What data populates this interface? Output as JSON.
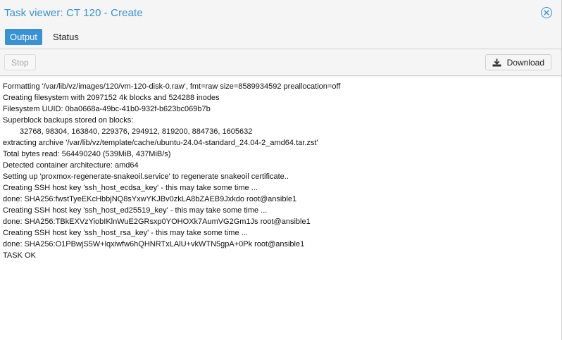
{
  "window": {
    "title": "Task viewer: CT 120 - Create"
  },
  "tabs": [
    {
      "label": "Output",
      "active": true
    },
    {
      "label": "Status",
      "active": false
    }
  ],
  "toolbar": {
    "stop_label": "Stop",
    "download_label": "Download"
  },
  "icons": {
    "close": "close-circle-icon",
    "download": "download-icon"
  },
  "colors": {
    "accent": "#3892d4"
  },
  "output": {
    "lines": [
      "Formatting '/var/lib/vz/images/120/vm-120-disk-0.raw', fmt=raw size=8589934592 preallocation=off",
      "Creating filesystem with 2097152 4k blocks and 524288 inodes",
      "Filesystem UUID: 0ba0668a-49bc-41b0-932f-b623bc069b7b",
      "Superblock backups stored on blocks:",
      "32768, 98304, 163840, 229376, 294912, 819200, 884736, 1605632",
      "extracting archive '/var/lib/vz/template/cache/ubuntu-24.04-standard_24.04-2_amd64.tar.zst'",
      "Total bytes read: 564490240 (539MiB, 437MiB/s)",
      "Detected container architecture: amd64",
      "Setting up 'proxmox-regenerate-snakeoil.service' to regenerate snakeoil certificate..",
      "Creating SSH host key 'ssh_host_ecdsa_key' - this may take some time ...",
      "done: SHA256:fwstTyeEKcHbbjNQ8sYxwYKJBv0zkLA8bZAEB9Jxkdo root@ansible1",
      "Creating SSH host key 'ssh_host_ed25519_key' - this may take some time ...",
      "done: SHA256:TBkEXVzYiobIKlnWuE2GRsxp0YOHOXk7AumVG2Gm1Js root@ansible1",
      "Creating SSH host key 'ssh_host_rsa_key' - this may take some time ...",
      "done: SHA256:O1PBwjS5W+lqxiwfw6hQHNRTxLAlU+vkWTN5gpA+0Pk root@ansible1",
      "TASK OK"
    ]
  }
}
